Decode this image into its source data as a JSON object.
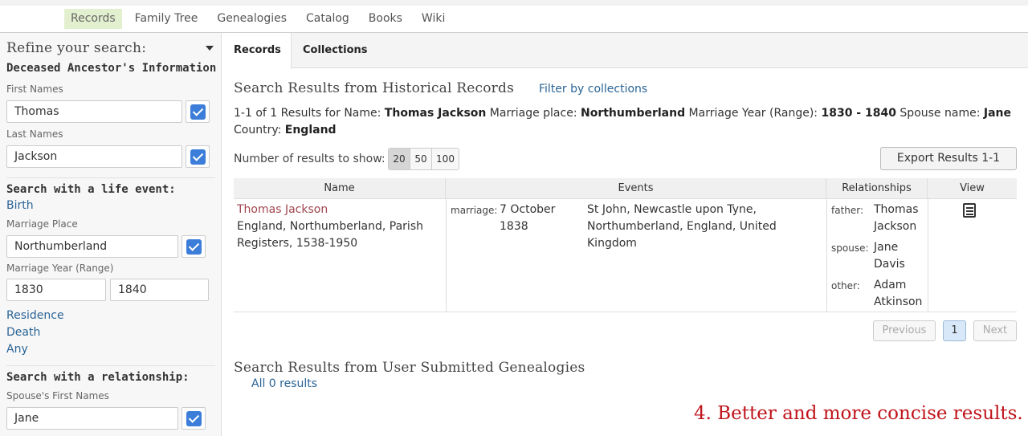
{
  "nav": {
    "items": [
      "Records",
      "Family Tree",
      "Genealogies",
      "Catalog",
      "Books",
      "Wiki"
    ],
    "active": "Records"
  },
  "sidebar": {
    "refine_title": "Refine your search:",
    "deceased_heading": "Deceased Ancestor's Information",
    "first_names_label": "First Names",
    "first_names_value": "Thomas",
    "last_names_label": "Last Names",
    "last_names_value": "Jackson",
    "life_event_heading": "Search with a life event:",
    "birth_link": "Birth",
    "marriage_place_label": "Marriage Place",
    "marriage_place_value": "Northumberland",
    "marriage_year_label": "Marriage Year (Range)",
    "year_from": "1830",
    "year_to": "1840",
    "residence_link": "Residence",
    "death_link": "Death",
    "any_link": "Any",
    "relationship_heading": "Search with a relationship:",
    "spouse_first_label": "Spouse's First Names",
    "spouse_first_value": "Jane"
  },
  "tabs": [
    "Records",
    "Collections"
  ],
  "main": {
    "historical_title": "Search Results from Historical Records",
    "filter_link": "Filter by collections",
    "summary": {
      "p1": "1-1 of 1 Results for Name: ",
      "name": "Thomas Jackson",
      "p2": " Marriage place: ",
      "place": "Northumberland",
      "p3": " Marriage Year (Range): ",
      "years": "1830 - 1840",
      "p4": " Spouse name: ",
      "spouse": "Jane",
      "p5": " Country: ",
      "country": "England"
    },
    "show_label": "Number of results to show:",
    "page_sizes": [
      "20",
      "50",
      "100"
    ],
    "export_label": "Export Results 1-1",
    "columns": [
      "Name",
      "Events",
      "Relationships",
      "View"
    ],
    "row": {
      "name": "Thomas Jackson",
      "collection": "England, Northumberland, Parish Registers, 1538-1950",
      "event_type": "marriage:",
      "event_date": "7 October 1838",
      "event_place": "St John, Newcastle upon Tyne, Northumberland, England, United Kingdom",
      "relations": [
        {
          "role": "father:",
          "name": "Thomas Jackson"
        },
        {
          "role": "spouse:",
          "name": "Jane Davis"
        },
        {
          "role": "other:",
          "name": "Adam Atkinson"
        }
      ]
    },
    "pager": {
      "prev": "Previous",
      "current": "1",
      "next": "Next"
    },
    "genealogies_title": "Search Results from User Submitted Genealogies",
    "all_results_link": "All 0 results"
  },
  "callout": "4. Better and more concise results.",
  "colors": {
    "accent_link": "#2a6496",
    "record_link": "#a0454e",
    "callout": "#c0141b",
    "check": "#3b7dd8"
  }
}
